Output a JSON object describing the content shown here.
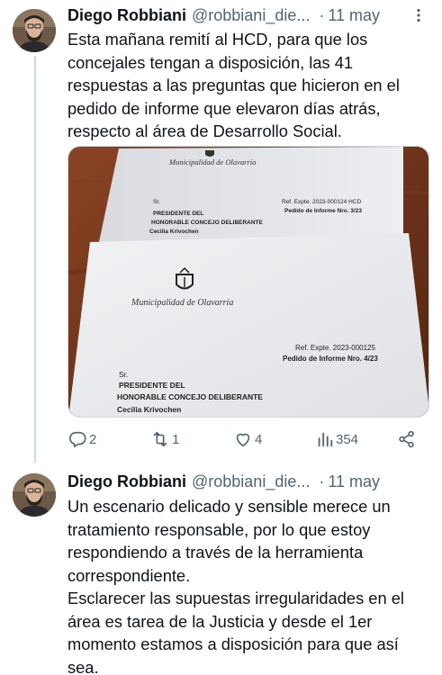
{
  "thread": {
    "tweets": [
      {
        "author_name": "Diego Robbiani",
        "handle": "@robbiani_die...",
        "separator": "·",
        "date": "11 may",
        "text": "Esta mañana remití al HCD, para que los concejales tengan a disposición, las 41 respuestas a las preguntas que hicieron en el pedido de informe que elevaron días atrás, respecto al área de Desarrollo Social.",
        "media": {
          "top_doc": {
            "municipality": "Municipalidad de Olavarría",
            "ref_expte": "Ref. Expte. 2023-000124 HCD",
            "pedido": "Pedido de Informe Nro. 3/23",
            "sr": "Sr.",
            "line1": "PRESIDENTE DEL",
            "line2": "HONORABLE CONCEJO DELIBERANTE",
            "line3": "Cecilia Krivochen"
          },
          "front_doc": {
            "municipality": "Municipalidad de Olavarría",
            "ref_expte": "Ref. Expte. 2023-000125",
            "pedido": "Pedido de Informe Nro. 4/23",
            "sr": "Sr.",
            "line1": "PRESIDENTE DEL",
            "line2": "HONORABLE CONCEJO DELIBERANTE",
            "line3": "Cecilia Krivochen"
          }
        },
        "actions": {
          "replies": "2",
          "retweets": "1",
          "likes": "4",
          "views": "354"
        }
      },
      {
        "author_name": "Diego Robbiani",
        "handle": "@robbiani_die...",
        "separator": "·",
        "date": "11 may",
        "paragraph1": "Un escenario delicado y sensible merece un tratamiento responsable, por lo que estoy respondiendo a través de la herramienta correspondiente.",
        "paragraph2": "Esclarecer las supuestas irregularidades en el área es tarea de la Justicia y desde el 1er momento estamos a disposición para que así sea."
      }
    ]
  },
  "colors": {
    "text_primary": "#0f1419",
    "text_secondary": "#536471",
    "thread_line": "#cfd9de",
    "wood": "#7a3d20"
  },
  "icons": [
    "more-icon",
    "reply-icon",
    "retweet-icon",
    "like-icon",
    "views-icon",
    "share-icon"
  ]
}
